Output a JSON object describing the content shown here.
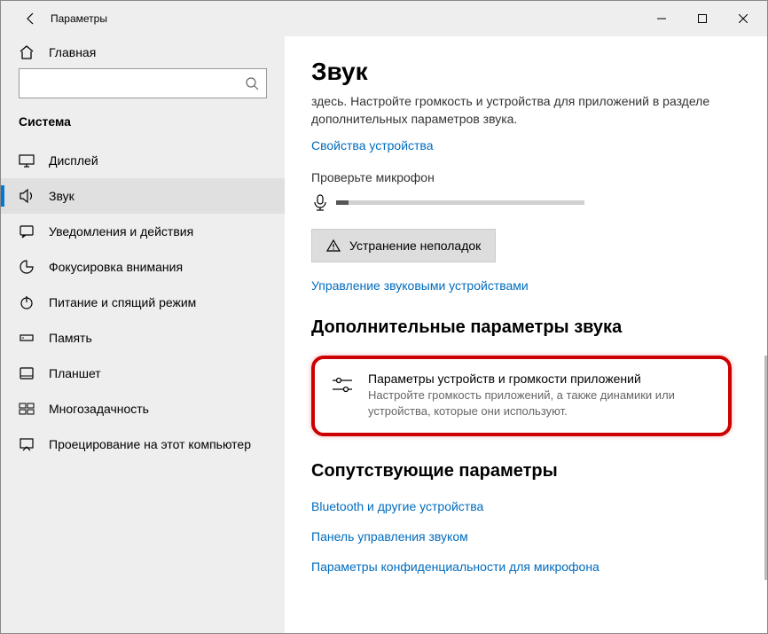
{
  "titlebar": {
    "title": "Параметры"
  },
  "sidebar": {
    "home": "Главная",
    "search_placeholder": "",
    "category": "Система",
    "items": [
      {
        "label": "Дисплей"
      },
      {
        "label": "Звук"
      },
      {
        "label": "Уведомления и действия"
      },
      {
        "label": "Фокусировка внимания"
      },
      {
        "label": "Питание и спящий режим"
      },
      {
        "label": "Память"
      },
      {
        "label": "Планшет"
      },
      {
        "label": "Многозадачность"
      },
      {
        "label": "Проецирование на этот компьютер"
      }
    ]
  },
  "main": {
    "title": "Звук",
    "intro": "здесь. Настройте громкость и устройства для приложений в разделе дополнительных параметров звука.",
    "device_props": "Свойства устройства",
    "check_mic": "Проверьте микрофон",
    "troubleshoot": "Устранение неполадок",
    "manage_devices": "Управление звуковыми устройствами",
    "adv_heading": "Дополнительные параметры звука",
    "adv_item_title": "Параметры устройств и громкости приложений",
    "adv_item_desc": "Настройте громкость приложений, а также динамики или устройства, которые они используют.",
    "related_heading": "Сопутствующие параметры",
    "related_links": [
      "Bluetooth и другие устройства",
      "Панель управления звуком",
      "Параметры конфиденциальности для микрофона"
    ]
  }
}
